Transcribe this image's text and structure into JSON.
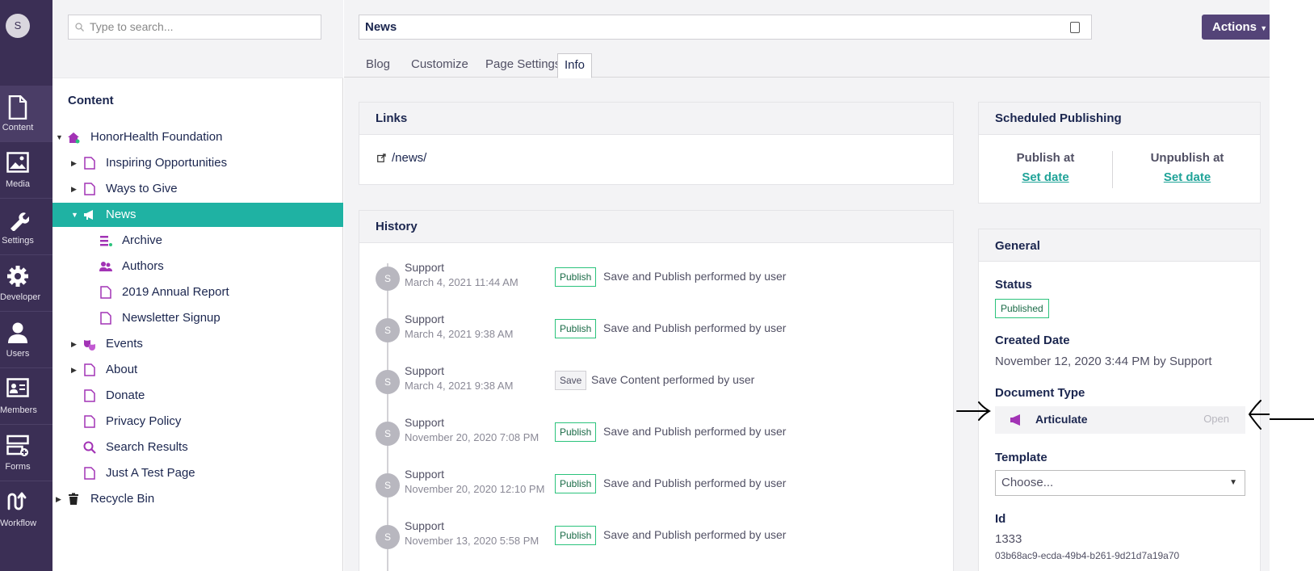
{
  "user": {
    "initial": "S"
  },
  "rail": [
    {
      "label": "Content",
      "icon": "document-icon",
      "active": true
    },
    {
      "label": "Media",
      "icon": "image-icon"
    },
    {
      "label": "Settings",
      "icon": "wrench-icon"
    },
    {
      "label": "Developer",
      "icon": "gear-icon"
    },
    {
      "label": "Users",
      "icon": "user-icon"
    },
    {
      "label": "Members",
      "icon": "id-card-icon"
    },
    {
      "label": "Forms",
      "icon": "form-icon"
    },
    {
      "label": "Workflow",
      "icon": "workflow-icon"
    }
  ],
  "tree": {
    "search_placeholder": "Type to search...",
    "title": "Content",
    "nodes": [
      {
        "label": "HonorHealth Foundation",
        "icon": "home-icon",
        "level": 0,
        "caret": "▼"
      },
      {
        "label": "Inspiring Opportunities",
        "icon": "page-icon",
        "level": 1,
        "caret": "▶"
      },
      {
        "label": "Ways to Give",
        "icon": "page-icon",
        "level": 1,
        "caret": "▶"
      },
      {
        "label": "News",
        "icon": "megaphone-icon",
        "level": 1,
        "caret": "▼",
        "selected": true
      },
      {
        "label": "Archive",
        "icon": "list-icon",
        "level": 2,
        "caret": ""
      },
      {
        "label": "Authors",
        "icon": "users-icon",
        "level": 2,
        "caret": ""
      },
      {
        "label": "2019 Annual Report",
        "icon": "page-icon",
        "level": 2,
        "caret": ""
      },
      {
        "label": "Newsletter Signup",
        "icon": "page-icon",
        "level": 2,
        "caret": ""
      },
      {
        "label": "Events",
        "icon": "masks-icon",
        "level": 1,
        "caret": "▶"
      },
      {
        "label": "About",
        "icon": "page-icon",
        "level": 1,
        "caret": "▶"
      },
      {
        "label": "Donate",
        "icon": "page-icon",
        "level": 1,
        "caret": ""
      },
      {
        "label": "Privacy Policy",
        "icon": "page-icon",
        "level": 1,
        "caret": ""
      },
      {
        "label": "Search Results",
        "icon": "search-icon",
        "level": 1,
        "caret": ""
      },
      {
        "label": "Just A Test Page",
        "icon": "page-icon",
        "level": 1,
        "caret": ""
      },
      {
        "label": "Recycle Bin",
        "icon": "trash-icon",
        "level": 0,
        "caret": "▶"
      }
    ]
  },
  "editor": {
    "name": "News",
    "actions_label": "Actions",
    "tabs": [
      "Blog",
      "Customize",
      "Page Settings",
      "Info"
    ],
    "active_tab": "Info"
  },
  "links": {
    "title": "Links",
    "url": "/news/"
  },
  "history": {
    "title": "History",
    "rows": [
      {
        "user": "Support",
        "initial": "S",
        "date": "March 4, 2021 11:44 AM",
        "badge": "Publish",
        "message": "Save and Publish performed by user"
      },
      {
        "user": "Support",
        "initial": "S",
        "date": "March 4, 2021 9:38 AM",
        "badge": "Publish",
        "message": "Save and Publish performed by user"
      },
      {
        "user": "Support",
        "initial": "S",
        "date": "March 4, 2021 9:38 AM",
        "badge": "Save",
        "message": "Save Content performed by user"
      },
      {
        "user": "Support",
        "initial": "S",
        "date": "November 20, 2020 7:08 PM",
        "badge": "Publish",
        "message": "Save and Publish performed by user"
      },
      {
        "user": "Support",
        "initial": "S",
        "date": "November 20, 2020 12:10 PM",
        "badge": "Publish",
        "message": "Save and Publish performed by user"
      },
      {
        "user": "Support",
        "initial": "S",
        "date": "November 13, 2020 5:58 PM",
        "badge": "Publish",
        "message": "Save and Publish performed by user"
      }
    ]
  },
  "scheduled": {
    "title": "Scheduled Publishing",
    "publish_label": "Publish at",
    "unpublish_label": "Unpublish at",
    "set_date": "Set date"
  },
  "general": {
    "title": "General",
    "status_label": "Status",
    "status_value": "Published",
    "created_label": "Created Date",
    "created_value": "November 12, 2020 3:44 PM by Support",
    "doctype_label": "Document Type",
    "doctype_value": "Articulate",
    "doctype_open": "Open",
    "template_label": "Template",
    "template_value": "Choose...",
    "id_label": "Id",
    "id_value": "1333",
    "guid": "03b68ac9-ecda-49b4-b261-9d21d7a19a70"
  },
  "colors": {
    "rail": "#3b2f55",
    "selected": "#1fb2a3",
    "actions": "#544478",
    "publish_badge": "#2bc37c"
  }
}
